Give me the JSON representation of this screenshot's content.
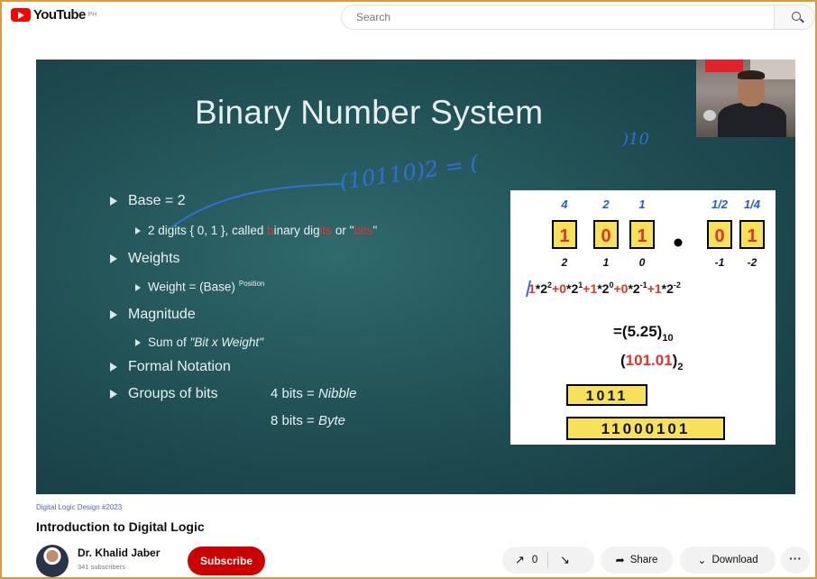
{
  "header": {
    "logo_text": "YouTube",
    "logo_sup": "PH",
    "search_placeholder": "Search"
  },
  "slide": {
    "title": "Binary Number System",
    "bullets": [
      {
        "label": "Base = 2"
      },
      {
        "label": "Weights"
      },
      {
        "label": "Magnitude"
      },
      {
        "label": "Formal Notation"
      },
      {
        "label": "Groups of bits"
      }
    ],
    "sub": {
      "digits_prefix": "2 digits { 0, 1 }, called ",
      "digits_b": "b",
      "digits_mid": "inary dig",
      "digits_it": "its",
      "digits_or": " or \"",
      "digits_bits": "bits",
      "digits_end": "\"",
      "weight_text": "Weight = (Base)",
      "weight_sup": "Position",
      "sum_prefix": "Sum of ",
      "sum_italic": "\"Bit x Weight\""
    },
    "groups": {
      "nibble_left": "4 bits = ",
      "nibble_right": "Nibble",
      "byte_left": "8 bits = ",
      "byte_right": "Byte"
    },
    "panel": {
      "weights_top": [
        "4",
        "2",
        "1",
        "1/2",
        "1/4"
      ],
      "digits": [
        "1",
        "0",
        "1",
        "0",
        "1"
      ],
      "positions": [
        "2",
        "1",
        "0",
        "-1",
        "-2"
      ],
      "result_decimal": "=(5.25)",
      "result_decimal_sub": "10",
      "result_binary_paren_open": "(",
      "result_binary_value": "101.01",
      "result_binary_paren_close": ")",
      "result_binary_sub": "2",
      "nibble_example": "1011",
      "byte_example": "11000101"
    },
    "ink": {
      "annotation": "(10110)2 = (",
      "subscript_ten": ")10"
    }
  },
  "video_info": {
    "hashtags": "Digital Logic Design #2023",
    "title": "Introduction to Digital Logic",
    "channel_name": "Dr. Khalid Jaber",
    "subscriber_count": "341 subscribers",
    "subscribe_label": "Subscribe",
    "like_count": "0",
    "share_label": "Share",
    "download_label": "Download",
    "more_label": "···"
  },
  "colors": {
    "accent_red": "#cc0000",
    "slide_bg": "#1f4d52",
    "ink_blue": "#2f6fd8",
    "digit_box": "#f7e15a"
  }
}
